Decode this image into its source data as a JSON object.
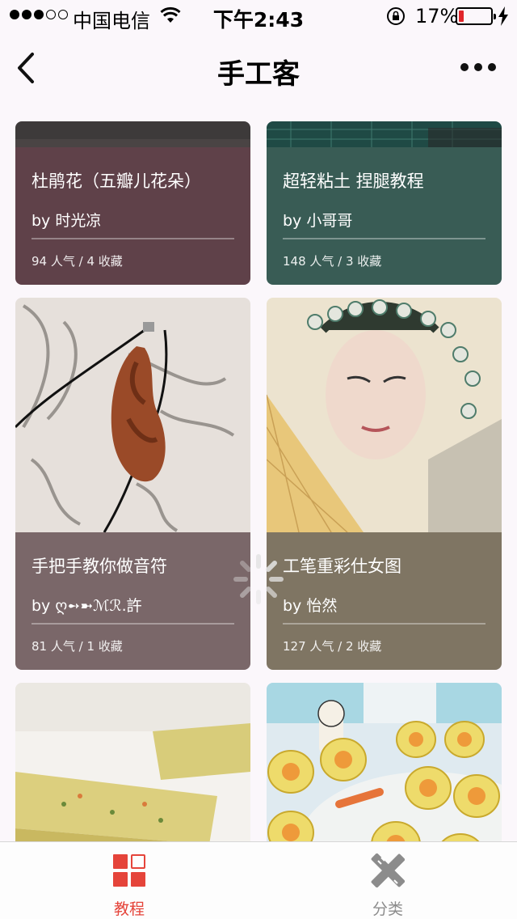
{
  "status_bar": {
    "carrier": "中国电信",
    "time": "下午2:43",
    "battery_percent": "17%",
    "battery_level": 0.17,
    "signal_bars": 3
  },
  "nav": {
    "title": "手工客",
    "back_icon": "chevron-left-icon",
    "more_icon": "more-dots-icon"
  },
  "cards": [
    {
      "title": "杜鹃花（五瓣儿花朵）",
      "author": "by 时光凉",
      "stats": "94 人气 / 4 收藏",
      "color": "#5f4149"
    },
    {
      "title": "超轻粘土 捏腿教程",
      "author": "by 小哥哥",
      "stats": "148 人气 / 3 收藏",
      "color": "#395c55"
    },
    {
      "title": "手把手教你做音符",
      "author": "by ღ➻➼ℳℛ.許",
      "stats": "81 人气 / 1 收藏",
      "color": "#7a6769"
    },
    {
      "title": "工笔重彩仕女图",
      "author": "by 怡然",
      "stats": "127 人气 / 2 收藏",
      "color": "#7f7563"
    },
    {
      "title": "",
      "author": "",
      "stats": "",
      "color": "#d8c98e"
    },
    {
      "title": "",
      "author": "",
      "stats": "",
      "color": "#c9b45a"
    }
  ],
  "tabs": [
    {
      "label": "教程",
      "icon": "grid-icon",
      "active": true,
      "color": "#e5443a"
    },
    {
      "label": "分类",
      "icon": "pencil-ruler-icon",
      "active": false,
      "color": "#8c8c8c"
    }
  ]
}
